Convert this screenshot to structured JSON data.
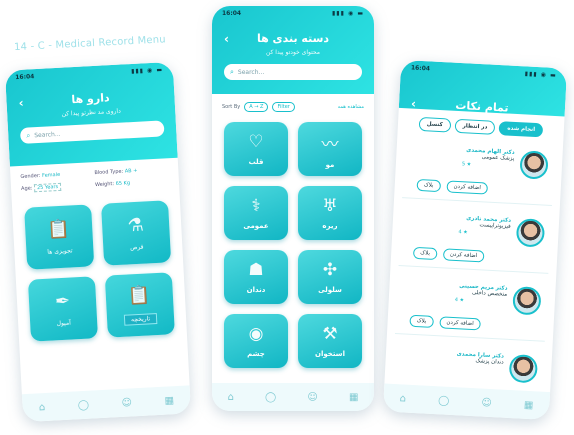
{
  "caption": "14 - C - Medical Record Menu",
  "status_time": "16:04",
  "left": {
    "title": "دارو ها",
    "subtitle": "داروی مد نظرتو پیدا کن",
    "search_placeholder": "Search...",
    "info": [
      {
        "label": "Gender:",
        "value": "Female"
      },
      {
        "label": "Blood Type:",
        "value": "AB +"
      },
      {
        "label": "Age:",
        "value": "25 Years"
      },
      {
        "label": "Weight:",
        "value": "65 Kg"
      }
    ],
    "tiles": [
      {
        "label": "تجویزی ها",
        "icon": "clipboard-icon"
      },
      {
        "label": "قرص",
        "icon": "pill-bottle-icon"
      },
      {
        "label": "آمپول",
        "icon": "syringe-icon"
      },
      {
        "label": "تاریخچه",
        "icon": "history-icon"
      }
    ]
  },
  "middle": {
    "title": "دسته بندی ها",
    "subtitle": "محتوای خودتو پیدا کن",
    "search_placeholder": "Search...",
    "sort_label": "Sort By",
    "sort_value": "A → Z",
    "filter_label": "Filter",
    "see_all": "مشاهده همه",
    "tiles": [
      {
        "label": "قلب",
        "icon": "heart-icon"
      },
      {
        "label": "مو",
        "icon": "hair-icon"
      },
      {
        "label": "عمومی",
        "icon": "doctor-icon"
      },
      {
        "label": "ریره",
        "icon": "lungs-icon"
      },
      {
        "label": "دندان",
        "icon": "tooth-icon"
      },
      {
        "label": "سلولی",
        "icon": "dna-icon"
      },
      {
        "label": "چشم",
        "icon": "eye-icon"
      },
      {
        "label": "استخوان",
        "icon": "bone-icon"
      }
    ]
  },
  "right": {
    "title": "تمام نکات",
    "tabs": [
      {
        "label": "انجام شده",
        "active": true
      },
      {
        "label": "در انتظار",
        "active": false
      },
      {
        "label": "کنسل",
        "active": false
      }
    ],
    "doctors": [
      {
        "name": "دکتر الهام محمدی",
        "specialty": "پزشک عمومی",
        "rating": "5",
        "btn_primary": "بلاک",
        "btn_secondary": "اضافه کردن"
      },
      {
        "name": "دکتر محمد نادری",
        "specialty": "فیزیوتراپیست",
        "rating": "4",
        "btn_primary": "بلاک",
        "btn_secondary": "اضافه کردن"
      },
      {
        "name": "دکتر مریم حسینی",
        "specialty": "متخصص داخلی",
        "rating": "4",
        "btn_primary": "بلاک",
        "btn_secondary": "اضافه کردن"
      },
      {
        "name": "دکتر سارا محمدی",
        "specialty": "دندان پزشک",
        "rating": "",
        "btn_primary": "",
        "btn_secondary": ""
      }
    ]
  },
  "colors": {
    "accent": "#19c6cf",
    "accent2": "#2ee3e3"
  }
}
